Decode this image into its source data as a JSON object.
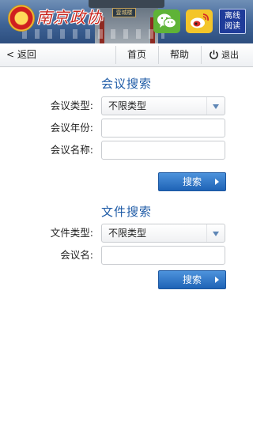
{
  "banner": {
    "logo_text": "南京政协",
    "plaque_text": "壹城楼",
    "offline_line1": "离线",
    "offline_line2": "阅读",
    "wechat_icon": "wechat-icon",
    "weibo_icon": "weibo-icon"
  },
  "nav": {
    "back": "< 返回",
    "home": "首页",
    "help": "帮助",
    "exit": "退出"
  },
  "meeting_search": {
    "title": "会议搜索",
    "type_label": "会议类型:",
    "type_value": "不限类型",
    "year_label": "会议年份:",
    "year_value": "",
    "name_label": "会议名称:",
    "name_value": "",
    "button": "搜索"
  },
  "file_search": {
    "title": "文件搜索",
    "type_label": "文件类型:",
    "type_value": "不限类型",
    "meeting_label": "会议名:",
    "meeting_value": "",
    "button": "搜索"
  },
  "colors": {
    "accent": "#1d5aa6",
    "button": "#1f63b6",
    "banner": "#3f6496"
  }
}
